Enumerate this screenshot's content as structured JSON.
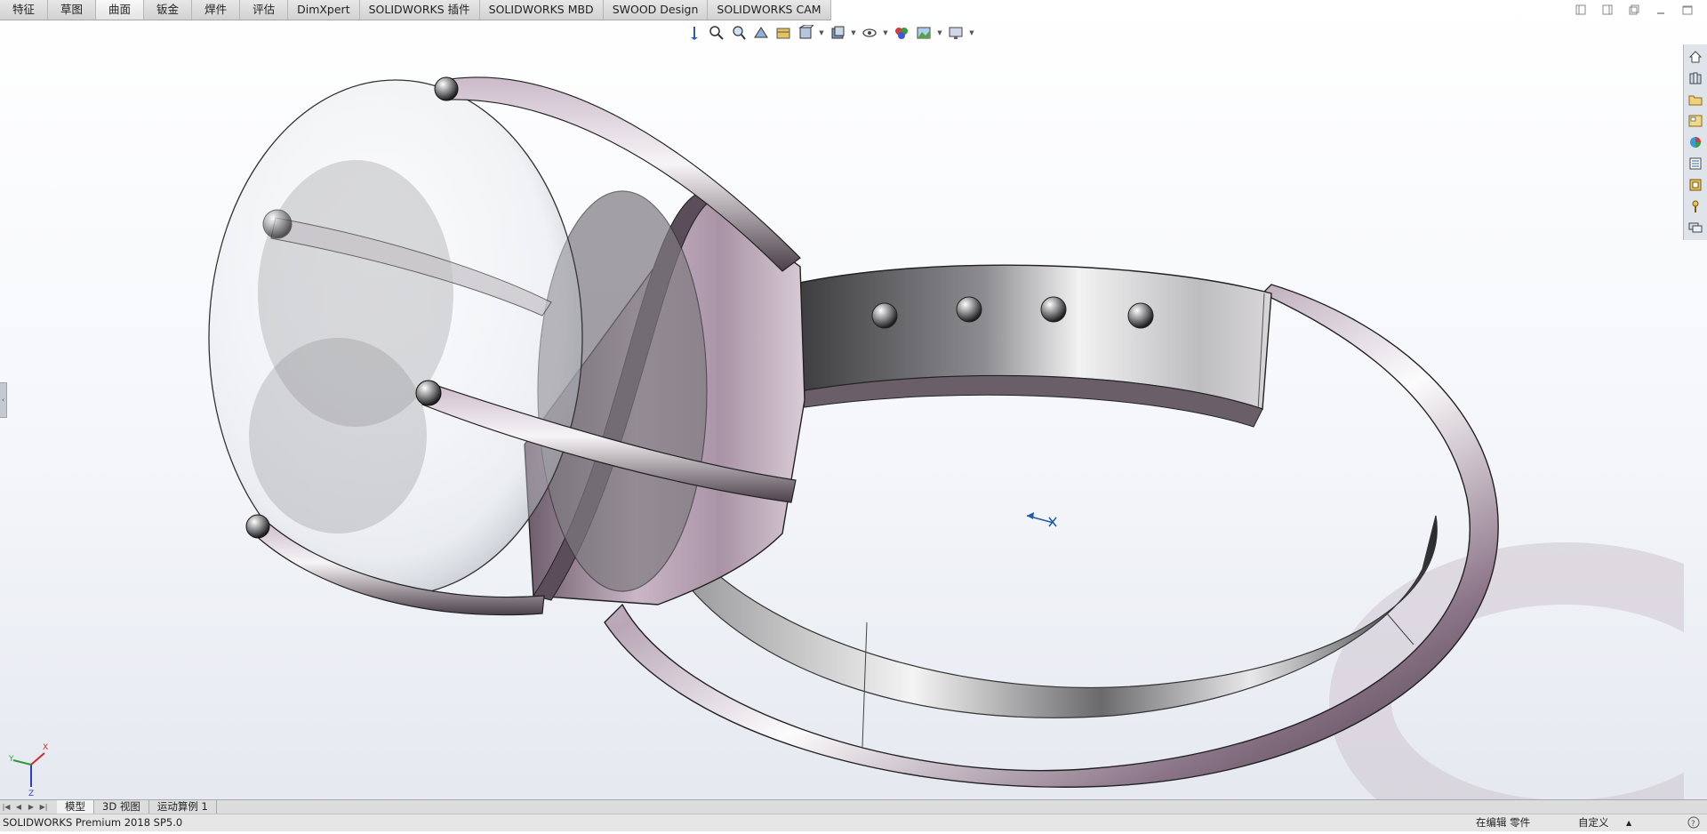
{
  "tabs": [
    {
      "label": "特征",
      "active": false
    },
    {
      "label": "草图",
      "active": false
    },
    {
      "label": "曲面",
      "active": true
    },
    {
      "label": "钣金",
      "active": false
    },
    {
      "label": "焊件",
      "active": false
    },
    {
      "label": "评估",
      "active": false
    },
    {
      "label": "DimXpert",
      "active": false
    },
    {
      "label": "SOLIDWORKS 插件",
      "active": false
    },
    {
      "label": "SOLIDWORKS MBD",
      "active": false
    },
    {
      "label": "SWOOD Design",
      "active": false
    },
    {
      "label": "SOLIDWORKS CAM",
      "active": false
    }
  ],
  "hud_toolbar": [
    "zoom-to-fit-icon",
    "zoom-to-area-icon",
    "previous-view-icon",
    "section-view-icon",
    "dynamic-annotation-icon",
    "view-orientation-icon",
    "display-style-icon",
    "hide-show-items-icon",
    "edit-appearance-icon",
    "apply-scene-icon",
    "view-settings-icon"
  ],
  "task_pane": [
    "solidworks-resources-icon",
    "design-library-icon",
    "file-explorer-icon",
    "view-palette-icon",
    "appearances-scenes-icon",
    "custom-properties-icon",
    "solidworks-forum-icon",
    "3dexperience-icon",
    "comments-icon"
  ],
  "triad": {
    "x": "X",
    "y": "Y",
    "z": "Z"
  },
  "model_tabs": [
    {
      "label": "模型",
      "active": true
    },
    {
      "label": "3D 视图",
      "active": false
    },
    {
      "label": "运动算例 1",
      "active": false
    }
  ],
  "status": {
    "product": "SOLIDWORKS Premium 2018 SP5.0",
    "mode": "在编辑 零件",
    "units": "自定义"
  },
  "colors": {
    "accent": "#1e5aa8",
    "metal_mauve": "#9a8298",
    "metal_dark": "#2a2a2e"
  }
}
